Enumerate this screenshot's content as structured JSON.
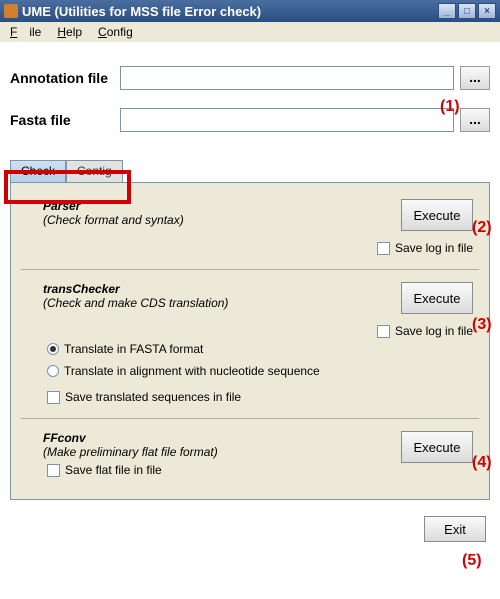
{
  "window": {
    "title": "UME (Utilities for MSS file Error check)",
    "minimize": "_",
    "maximize": "□",
    "close": "×"
  },
  "menubar": {
    "file": "File",
    "help": "Help",
    "config": "Config"
  },
  "files": {
    "annotation_label": "Annotation file",
    "annotation_value": "",
    "fasta_label": "Fasta  file",
    "fasta_value": "",
    "browse": "..."
  },
  "tabs": {
    "check": "Check",
    "contig": "Contig"
  },
  "parser": {
    "title": "Parser",
    "subtitle": "(Check format and syntax)",
    "execute": "Execute",
    "savelog": "Save log in file"
  },
  "trans": {
    "title": "transChecker",
    "subtitle": "(Check and make CDS translation)",
    "opt1": "Translate in FASTA format",
    "opt2": "Translate in alignment with nucleotide sequence",
    "saveseq": "Save translated sequences in file",
    "execute": "Execute",
    "savelog": "Save log in file"
  },
  "ffconv": {
    "title": "FFconv",
    "subtitle": "(Make preliminary flat file format)",
    "saveflat": "Save flat file in file",
    "execute": "Execute"
  },
  "exit": "Exit",
  "annotations": {
    "a1": "(1)",
    "a2": "(2)",
    "a3": "(3)",
    "a4": "(4)",
    "a5": "(5)"
  }
}
